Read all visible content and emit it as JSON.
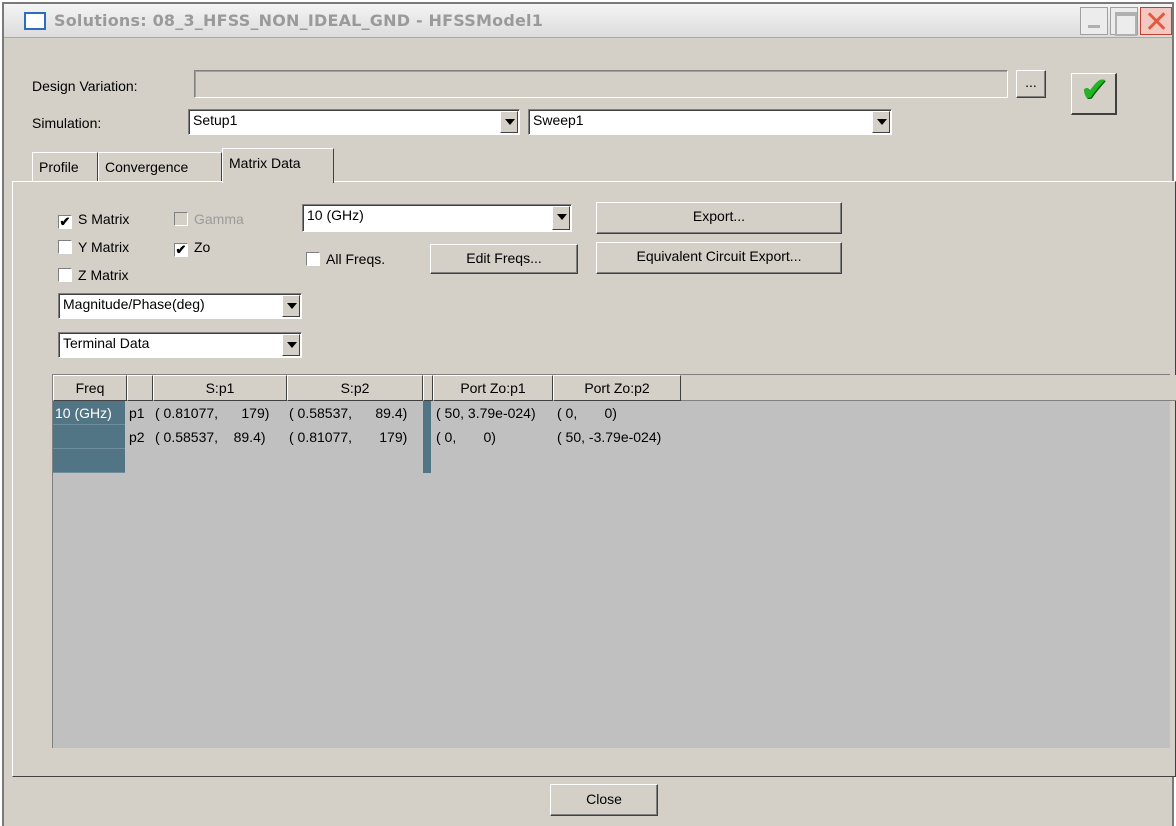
{
  "window": {
    "title": "Solutions: 08_3_HFSS_NON_IDEAL_GND - HFSSModel1",
    "close_symbol": "✕"
  },
  "design_variation": {
    "label": "Design Variation:",
    "value": "",
    "browse_label": "..."
  },
  "simulation": {
    "label": "Simulation:",
    "setup": "Setup1",
    "sweep": "Sweep1"
  },
  "apply_icon": "checkmark-icon",
  "apply_symbol": "✔",
  "tabs": [
    {
      "label": "Profile",
      "active": false
    },
    {
      "label": "Convergence",
      "active": false
    },
    {
      "label": "Matrix Data",
      "active": true
    }
  ],
  "matrix_options": {
    "s_matrix": {
      "label": "S Matrix",
      "checked": true
    },
    "gamma": {
      "label": "Gamma",
      "checked": false,
      "disabled": true
    },
    "y_matrix": {
      "label": "Y Matrix",
      "checked": false
    },
    "zo": {
      "label": "Zo",
      "checked": true
    },
    "z_matrix": {
      "label": "Z Matrix",
      "checked": false
    },
    "format": "Magnitude/Phase(deg)",
    "data_type": "Terminal Data"
  },
  "freq": {
    "selected": "10 (GHz)",
    "all_freqs": {
      "label": "All Freqs.",
      "checked": false
    },
    "edit_label": "Edit Freqs..."
  },
  "buttons": {
    "export": "Export...",
    "equivalent_export": "Equivalent Circuit Export...",
    "close": "Close"
  },
  "check_mark": "✔",
  "table": {
    "headers": [
      "Freq",
      "",
      "S:p1",
      "S:p2",
      "Port Zo:p1",
      "Port Zo:p2"
    ],
    "freq_value": "10 (GHz)",
    "rows": [
      {
        "port": "p1",
        "s_p1": "( 0.81077,      179)",
        "s_p2": "( 0.58537,      89.4)",
        "zo_p1": "( 50, 3.79e-024)",
        "zo_p2": "( 0,       0)"
      },
      {
        "port": "p2",
        "s_p1": "( 0.58537,    89.4)",
        "s_p2": "( 0.81077,       179)",
        "zo_p1": "( 0,       0)",
        "zo_p2": "( 50, -3.79e-024)"
      }
    ]
  }
}
